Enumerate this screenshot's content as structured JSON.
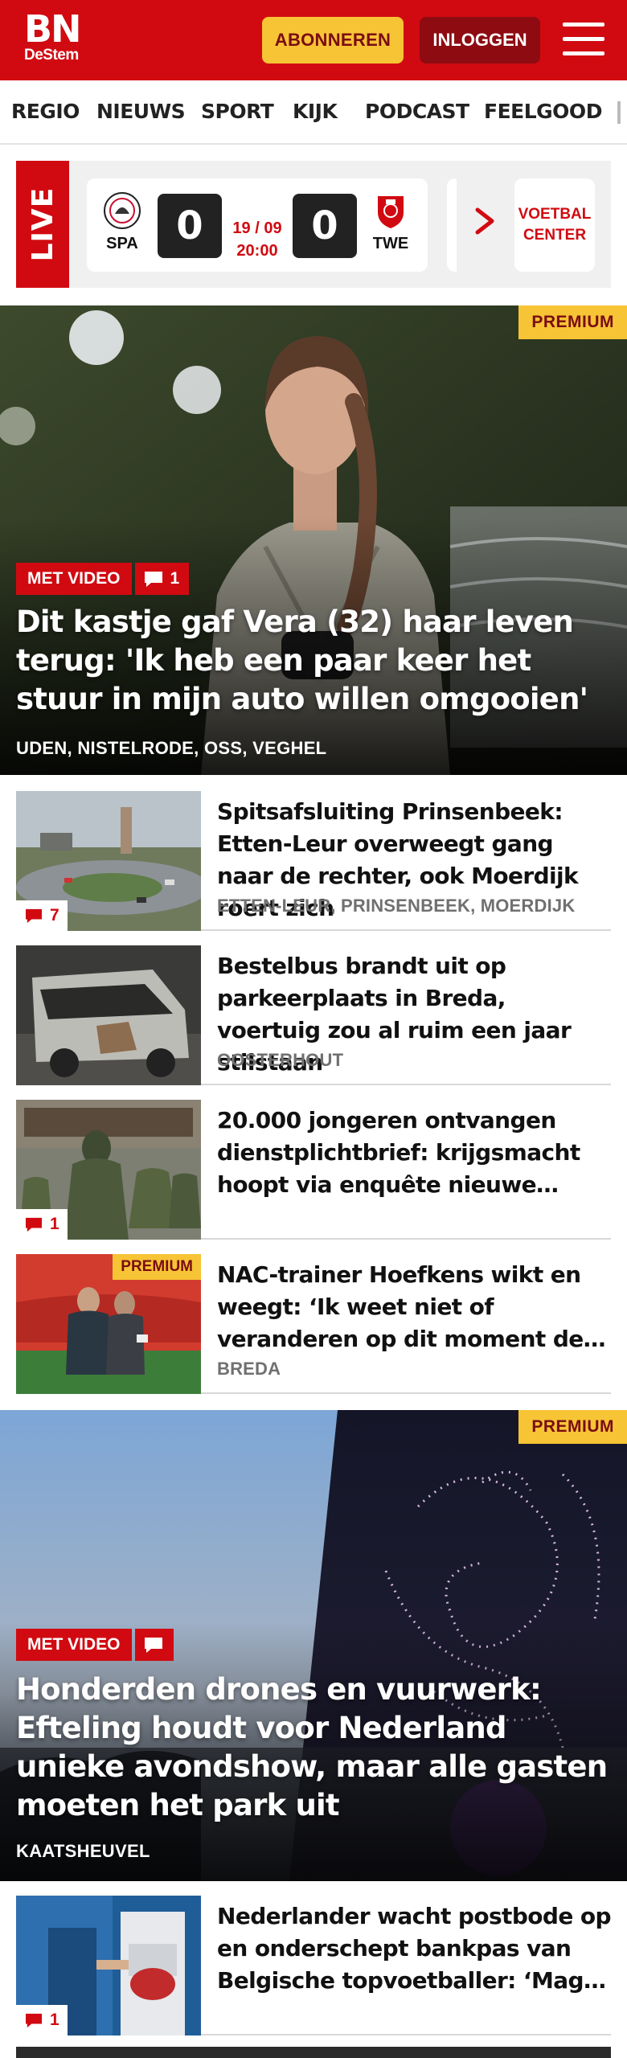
{
  "header": {
    "logo_main": "BN",
    "logo_sub": "DeStem",
    "subscribe_label": "ABONNEREN",
    "login_label": "INLOGGEN"
  },
  "nav": {
    "items": [
      "REGIO",
      "NIEUWS",
      "SPORT",
      "KIJK",
      "PODCAST",
      "FEELGOOD"
    ]
  },
  "live": {
    "label": "LIVE",
    "match": {
      "home": "SPA",
      "away": "TWE",
      "home_score": "0",
      "away_score": "0",
      "date": "19 / 09",
      "time": "20:00"
    },
    "football_center_line1": "VOETBAL",
    "football_center_line2": "CENTER"
  },
  "hero1": {
    "premium": "PREMIUM",
    "video_label": "MET VIDEO",
    "comments": "1",
    "title": "Dit kastje gaf Vera (32) haar leven terug: 'Ik heb een paar keer het stuur in mijn auto willen omgooien'",
    "location": "UDEN, NISTELRODE, OSS, VEGHEL"
  },
  "articles": [
    {
      "title": "Spitsafsluiting Prinsenbeek: Etten-Leur overweegt gang naar de rechter, ook Moerdijk roert zich",
      "location": "ETTEN-LEUR, PRINSENBEEK, MOERDIJK",
      "comments": "7"
    },
    {
      "title": "Bestelbus brandt uit op parkeerplaats in Breda, voertuig zou al ruim een jaar stilstaan",
      "location": "OOSTERHOUT"
    },
    {
      "title": "20.000 jongeren ontvangen dienstplichtbrief: krijgsmacht hoopt via enquête nieuwe rekruten te vinden",
      "comments": "1"
    },
    {
      "title": "NAC-trainer Hoefkens wikt en weegt: ‘Ik weet niet of veranderen op dit moment de oplossing is’",
      "location": "BREDA",
      "premium": "PREMIUM"
    }
  ],
  "hero2": {
    "premium": "PREMIUM",
    "video_label": "MET VIDEO",
    "title": "Honderden drones en vuurwerk: Efteling houdt voor Nederland unieke avondshow, maar alle gasten moeten het park uit",
    "location": "KAATSHEUVEL"
  },
  "article_last": {
    "title": "Nederlander wacht postbode op en onderschept bankpas van Belgische topvoetballer: ‘Mag je de kaart van iemand anders gebruiken?’",
    "comments": "1"
  },
  "colors": {
    "brand_red": "#d10a11",
    "dark_red": "#8e0b12",
    "premium_yellow": "#f7c435"
  },
  "icons": [
    "hamburger-menu-icon",
    "comment-icon",
    "chevron-right-icon",
    "club-crest-icon"
  ]
}
